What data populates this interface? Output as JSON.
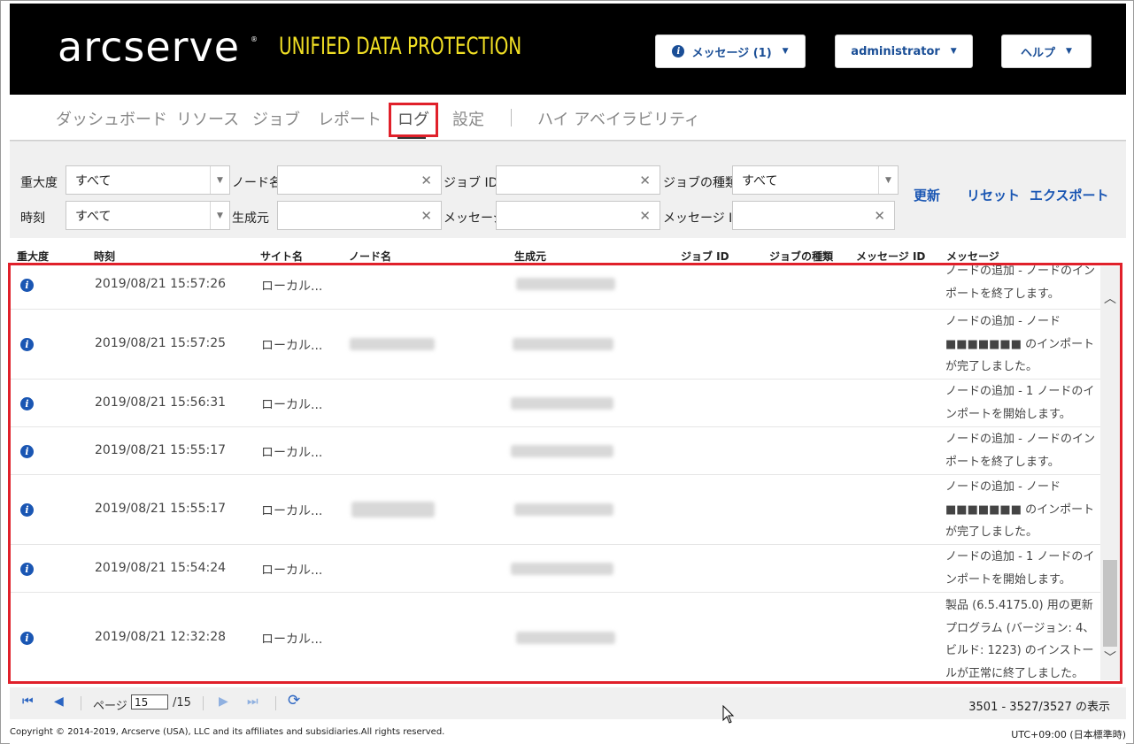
{
  "header": {
    "logo": "arcserve",
    "logo_reg": "®",
    "product": "UNIFIED DATA PROTECTION",
    "messages_label": "メッセージ (1)",
    "messages_icon": "info-icon",
    "admin_label": "administrator",
    "help_label": "ヘルプ"
  },
  "nav": {
    "dashboard": "ダッシュボード",
    "resources": "リソース",
    "jobs": "ジョブ",
    "reports": "レポート",
    "logs": "ログ",
    "settings": "設定",
    "ha": "ハイ アベイラビリティ",
    "active": "ログ"
  },
  "filters": {
    "severity_label": "重大度",
    "severity_value": "すべて",
    "time_label": "時刻",
    "time_value": "すべて",
    "node_label": "ノード名",
    "node_value": "",
    "generated_label": "生成元",
    "generated_value": "",
    "jobid_label": "ジョブ ID",
    "jobid_value": "",
    "message_label": "メッセージ",
    "message_value": "",
    "jobtype_label": "ジョブの種類",
    "jobtype_value": "すべて",
    "msgid_label": "メッセージ ID",
    "msgid_value": "",
    "clear_glyph": "✕",
    "refresh": "更新",
    "reset": "リセット",
    "export": "エクスポート"
  },
  "columns": {
    "severity": "重大度",
    "time": "時刻",
    "site": "サイト名",
    "node": "ノード名",
    "generated": "生成元",
    "jobid": "ジョブ ID",
    "jobtype": "ジョブの種類",
    "msgid": "メッセージ ID",
    "message": "メッセージ"
  },
  "rows": [
    {
      "time": "2019/08/21 15:57:26",
      "site": "ローカル...",
      "message": "ノードの追加 - ノードのインポートを終了します。"
    },
    {
      "time": "2019/08/21 15:57:25",
      "site": "ローカル...",
      "message": "ノードの追加 - ノード ■■■■■■■ のインポートが完了しました。"
    },
    {
      "time": "2019/08/21 15:56:31",
      "site": "ローカル...",
      "message": "ノードの追加 - 1 ノードのインポートを開始します。"
    },
    {
      "time": "2019/08/21 15:55:17",
      "site": "ローカル...",
      "message": "ノードの追加 - ノードのインポートを終了します。"
    },
    {
      "time": "2019/08/21 15:55:17",
      "site": "ローカル...",
      "message": "ノードの追加 - ノード ■■■■■■■ のインポートが完了しました。"
    },
    {
      "time": "2019/08/21 15:54:24",
      "site": "ローカル...",
      "message": "ノードの追加 - 1 ノードのインポートを開始します。"
    },
    {
      "time": "2019/08/21 12:32:28",
      "site": "ローカル...",
      "message": "製品 (6.5.4175.0) 用の更新プログラム (バージョン: 4、ビルド: 1223) のインストールが正常に終了しました。"
    }
  ],
  "pager": {
    "page_label": "ページ",
    "page_value": "15",
    "page_total": "/15",
    "display": "3501 - 3527/3527 の表示"
  },
  "footer": {
    "copyright": "Copyright © 2014-2019, Arcserve (USA), LLC and its affiliates and subsidiaries.All rights reserved.",
    "timezone": "UTC+09:00 (日本標準時)"
  },
  "colors": {
    "header_bg": "#000000",
    "product_yellow": "#f2e024",
    "link_blue": "#1a56b3",
    "highlight_red": "#e0202a"
  }
}
